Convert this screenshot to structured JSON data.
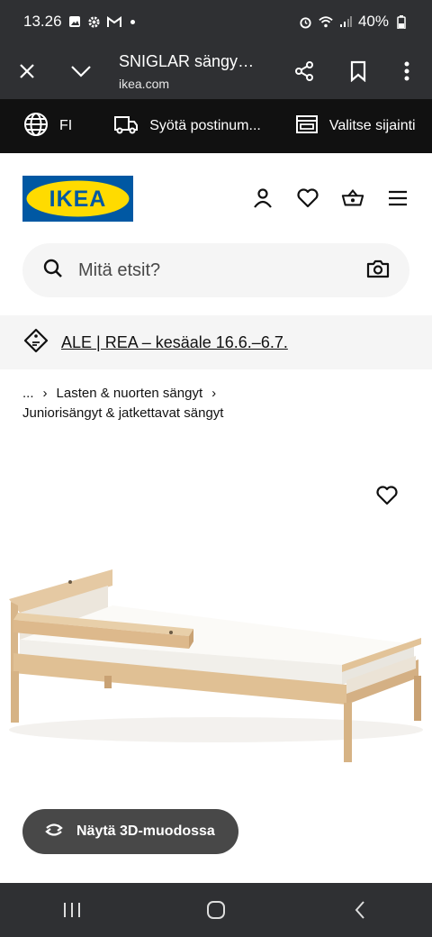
{
  "status_bar": {
    "time": "13.26",
    "battery": "40%",
    "icons": [
      "gallery-icon",
      "settings-icon",
      "gmail-icon",
      "alarm-icon",
      "wifi-icon",
      "signal-icon",
      "battery-icon"
    ]
  },
  "browser": {
    "title": "SNIGLAR sängynr...",
    "url": "ikea.com"
  },
  "utility_bar": {
    "language": "FI",
    "postcode": "Syötä postinum...",
    "store": "Valitse sijainti"
  },
  "header": {
    "logo_text": "IKEA",
    "brand_colors": {
      "blue": "#0058a3",
      "yellow": "#ffdb00"
    }
  },
  "search": {
    "placeholder": "Mitä etsit?"
  },
  "promo": {
    "text": "ALE | REA – kesäale 16.6.–6.7."
  },
  "breadcrumb": {
    "ellipsis": "...",
    "level1": "Lasten & nuorten sängyt",
    "level2": "Juniorisängyt & jatkettavat sängyt",
    "separator": "›"
  },
  "product": {
    "button_3d": "Näytä 3D-muodossa"
  }
}
